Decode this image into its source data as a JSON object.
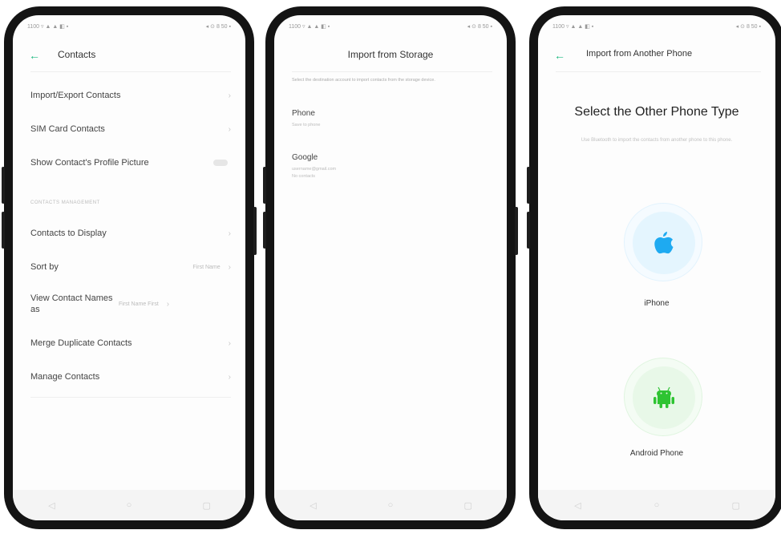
{
  "colors": {
    "accent": "#1eb980",
    "apple": "#1eaaf1",
    "android": "#2ec432"
  },
  "status": {
    "left": "1100 ▿ ▲ ▲ ◧ ▪",
    "right": "◂ ⊙ 8 50 ▪"
  },
  "phone1": {
    "title": "Contacts",
    "items_top": [
      {
        "label": "Import/Export Contacts"
      },
      {
        "label": "SIM Card Contacts"
      },
      {
        "label": "Show Contact's Profile Picture"
      }
    ],
    "section": "CONTACTS MANAGEMENT",
    "items_bottom": [
      {
        "label": "Contacts to Display",
        "value": ""
      },
      {
        "label": "Sort by",
        "value": "First Name"
      },
      {
        "label": "View Contact Names as",
        "value": "First Name First"
      },
      {
        "label": "Merge Duplicate Contacts",
        "value": ""
      },
      {
        "label": "Manage Contacts",
        "value": ""
      }
    ]
  },
  "phone2": {
    "title": "Import from Storage",
    "description": "Select the destination account to import contacts from the storage device.",
    "accounts": [
      {
        "name": "Phone",
        "sub": "Save to phone"
      },
      {
        "name": "Google",
        "sub": "username@gmail.com",
        "sub2": "No contacts"
      }
    ]
  },
  "phone3": {
    "title": "Import from Another Phone",
    "heading": "Select the Other Phone Type",
    "description": "Use Bluetooth to import the contacts from another phone to this phone.",
    "options": [
      {
        "label": "iPhone",
        "icon": "apple-icon"
      },
      {
        "label": "Android Phone",
        "icon": "android-icon"
      }
    ]
  },
  "navbar": {
    "back": "◁",
    "home": "○",
    "recent": "▢"
  }
}
